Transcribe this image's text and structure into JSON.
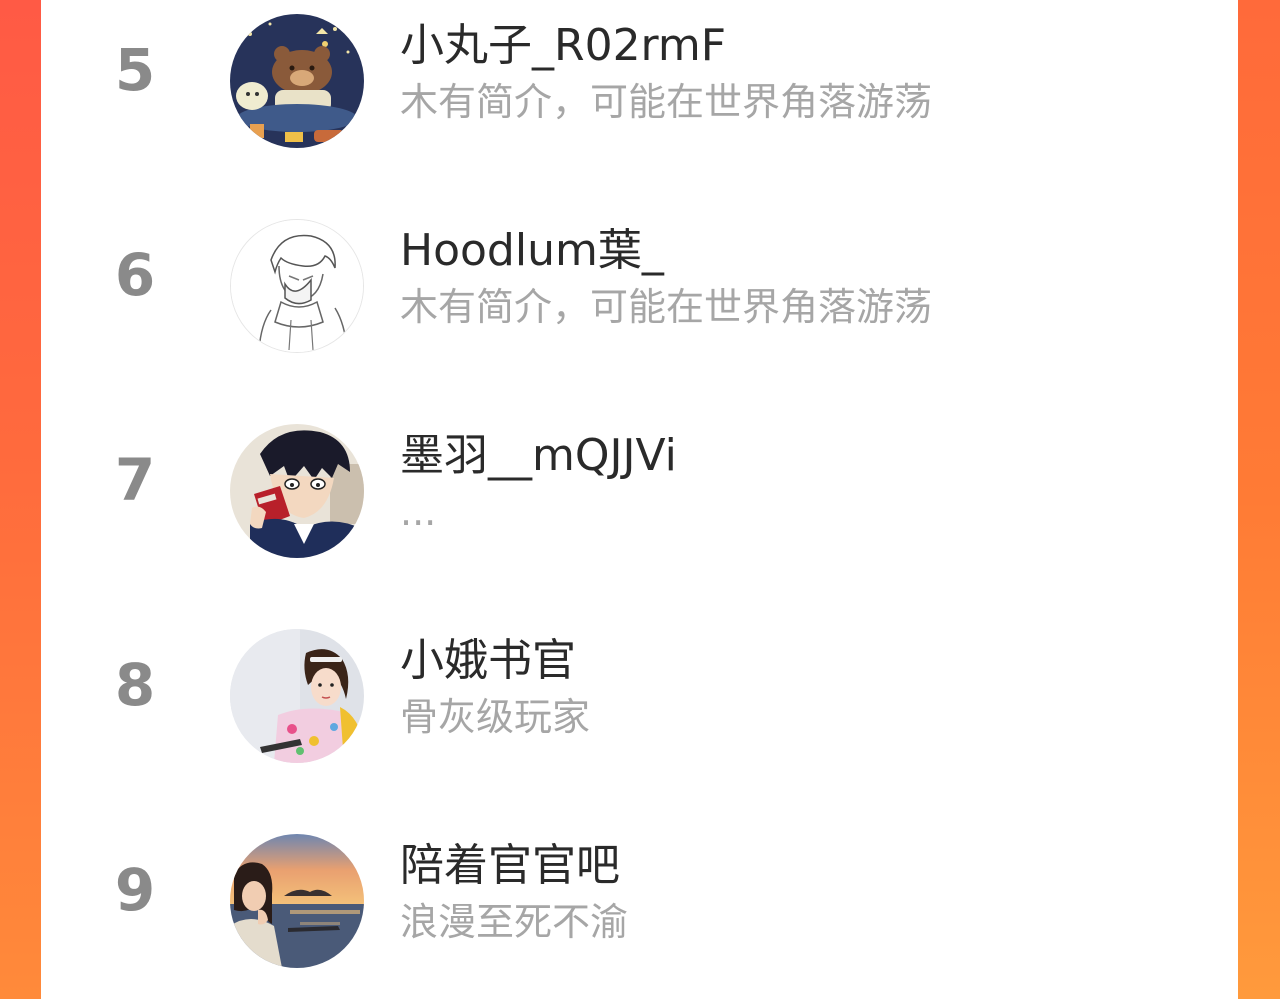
{
  "ranking_list": {
    "items": [
      {
        "rank": "5",
        "name": "小丸子_R02rmF",
        "bio": "木有简介，可能在世界角落游荡",
        "avatar_icon": "bear-illustration-avatar"
      },
      {
        "rank": "6",
        "name": "Hoodlum葉_",
        "bio": "木有简介，可能在世界角落游荡",
        "avatar_icon": "sketch-boy-avatar"
      },
      {
        "rank": "7",
        "name": "墨羽__mQJJVi",
        "bio": "...",
        "avatar_icon": "anime-boy-drinking-avatar"
      },
      {
        "rank": "8",
        "name": "小娥书官",
        "bio": "骨灰级玩家",
        "avatar_icon": "girl-photo-avatar"
      },
      {
        "rank": "9",
        "name": "陪着官官吧",
        "bio": "浪漫至死不渝",
        "avatar_icon": "sunset-sea-avatar"
      }
    ]
  },
  "colors": {
    "background_left": "#ff5a45",
    "background_right": "#ff8a3a",
    "panel": "#ffffff",
    "rank_text": "#8a8a8a",
    "name_text": "#2a2a2a",
    "bio_text": "#a6a6a6"
  }
}
